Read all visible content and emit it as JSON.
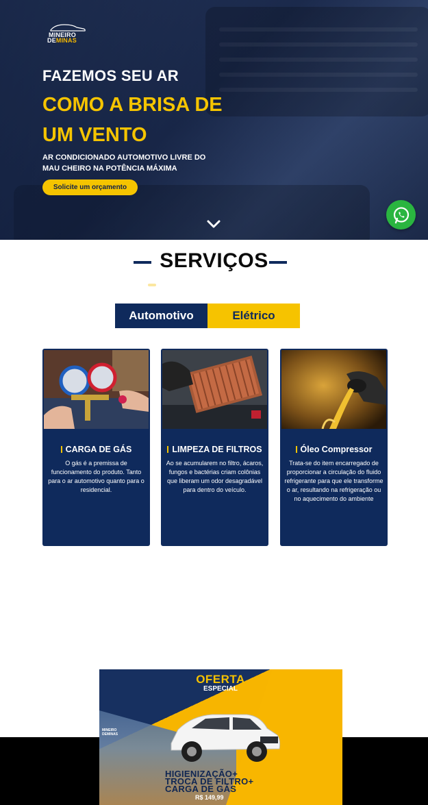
{
  "brand": {
    "line1": "MINEIRO",
    "line2a": "DE",
    "line2b": "MINAS"
  },
  "hero": {
    "title_white": "FAZEMOS SEU AR",
    "title_yellow_1": "COMO A BRISA DE",
    "title_yellow_2": "UM VENTO",
    "subtitle": "AR CONDICIONADO AUTOMOTIVO LIVRE DO MAU CHEIRO NA POTÊNCIA MÁXIMA",
    "cta_label": "Solicite um orçamento"
  },
  "services": {
    "heading": "SERVIÇOS",
    "tabs": [
      {
        "label": "Automotivo",
        "active": true
      },
      {
        "label": "Elétrico",
        "active": false
      }
    ],
    "cards": [
      {
        "title": "CARGA DE GÁS",
        "description": "O gás é a premissa de funcionamento do produto. Tanto para o ar automotivo quanto para o residencial."
      },
      {
        "title": "LIMPEZA DE FILTROS",
        "description": "Ao se acumularem no filtro, ácaros, fungos e bactérias criam colônias que liberam um odor desagradável para dentro do veículo."
      },
      {
        "title": "Óleo Compressor",
        "description": "Trata-se do item encarregado de proporcionar a circulação do fluido refrigerante para que ele transforme o ar, resultando na refrigeração ou no aquecimento do ambiente"
      }
    ]
  },
  "offer": {
    "title": "OFERTA",
    "subtitle": "ESPECIAL",
    "line1": "HIGIENIZAÇÃO+",
    "line2": "TROCA DE FILTRO+",
    "line3": "CARGA DE GÁS",
    "price": "R$ 149,99"
  },
  "colors": {
    "navy": "#0f2a5c",
    "yellow": "#f5c400",
    "whatsapp": "#2ab540"
  },
  "icons": {
    "scroll": "chevron-down-icon",
    "chat": "whatsapp-icon"
  }
}
